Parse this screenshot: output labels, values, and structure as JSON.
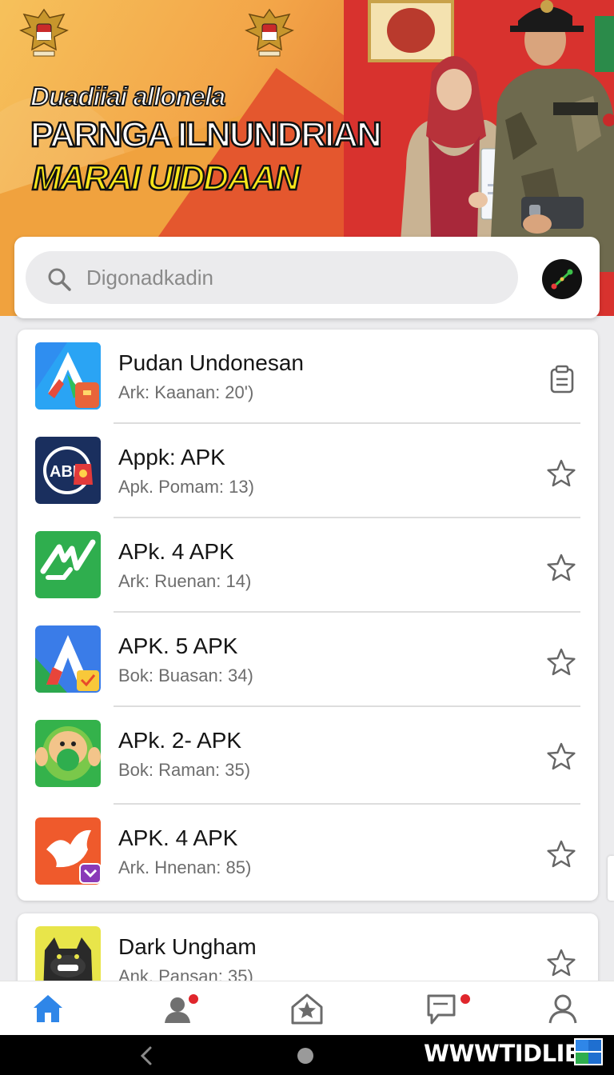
{
  "hero": {
    "line1": "Duadiiai allonela",
    "line2": "PARNGA ILNUNDRIAN",
    "line3": "MARAI UIDDAAN"
  },
  "search": {
    "placeholder": "Digonadkadin",
    "icon": "search-icon",
    "action_icon": "graph-icon"
  },
  "apps": [
    {
      "name": "Pudan Undonesan",
      "meta": "Ark: Kaanan: 20')",
      "icon": "app-store-icon",
      "action": "clipboard-icon",
      "color": "#2f8ef0"
    },
    {
      "name": "Appk: APK",
      "meta": "Apk. Pomam: 13)",
      "icon": "app-badge-icon",
      "action": "star-icon",
      "color": "#1a2f5e"
    },
    {
      "name": "APk. 4 APK",
      "meta": "Ark: Ruenan: 14)",
      "icon": "check-wave-icon",
      "action": "star-icon",
      "color": "#2fae4e"
    },
    {
      "name": "APK. 5 APK",
      "meta": "Bok: Buasan: 34)",
      "icon": "google-a-icon",
      "action": "star-icon",
      "color": "#3a7ce8"
    },
    {
      "name": "APk. 2- APK",
      "meta": "Bok: Raman: 35)",
      "icon": "cartoon-face-icon",
      "action": "star-icon",
      "color": "#34b24b"
    },
    {
      "name": "APK. 4 APK",
      "meta": "Ark. Hnenan: 85)",
      "icon": "wing-icon",
      "action": "star-icon",
      "color": "#ef5a2c"
    }
  ],
  "partial_app": {
    "name": "Dark Ungham",
    "meta": "Ank. Pansan: 35)",
    "icon": "dark-cat-icon",
    "action": "star-icon",
    "color": "#e8e54a"
  },
  "bottom_nav": [
    {
      "label": "home",
      "icon": "home-icon",
      "active": true
    },
    {
      "label": "profile-alert",
      "icon": "person-alert-icon",
      "badge": true
    },
    {
      "label": "favorites",
      "icon": "star-house-icon"
    },
    {
      "label": "messages",
      "icon": "chat-icon",
      "badge": true
    },
    {
      "label": "account",
      "icon": "user-icon"
    }
  ],
  "system_bar": {
    "watermark": "WWWTIDLIES"
  },
  "colors": {
    "accent": "#2f86e8",
    "badge": "#e0262c",
    "hero_yellow": "#f7e61a",
    "hero_red": "#d8322e"
  }
}
